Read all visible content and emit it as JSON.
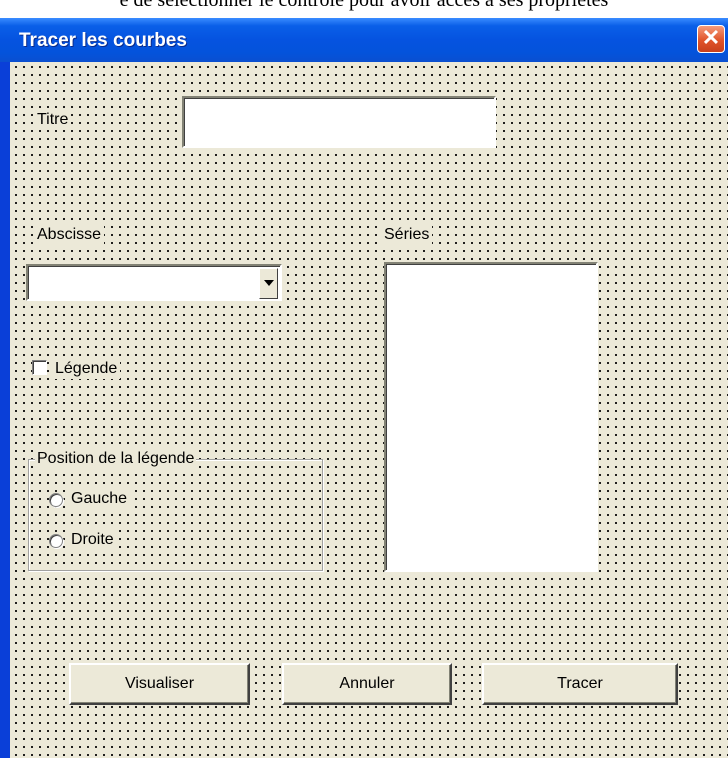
{
  "caption": "e de sélectionner le contrôle pour avoir accès à ses propriétés",
  "window": {
    "title": "Tracer les courbes",
    "close_glyph": "✕"
  },
  "form": {
    "titre_label": "Titre",
    "titre_value": "",
    "abscisse_label": "Abscisse",
    "abscisse_value": "",
    "series_label": "Séries",
    "series_items": [],
    "legende_label": "Légende",
    "legende_checked": false,
    "position_frame_label": "Position de la légende",
    "radio_gauche_label": "Gauche",
    "radio_droite_label": "Droite"
  },
  "buttons": {
    "visualiser": "Visualiser",
    "annuler": "Annuler",
    "tracer": "Tracer"
  },
  "colors": {
    "titlebar": "#0553e0",
    "dialog_background": "#ece9d8",
    "close_button": "#e0542a"
  },
  "icons": {
    "close": "close-icon",
    "dropdown": "chevron-down-icon"
  }
}
